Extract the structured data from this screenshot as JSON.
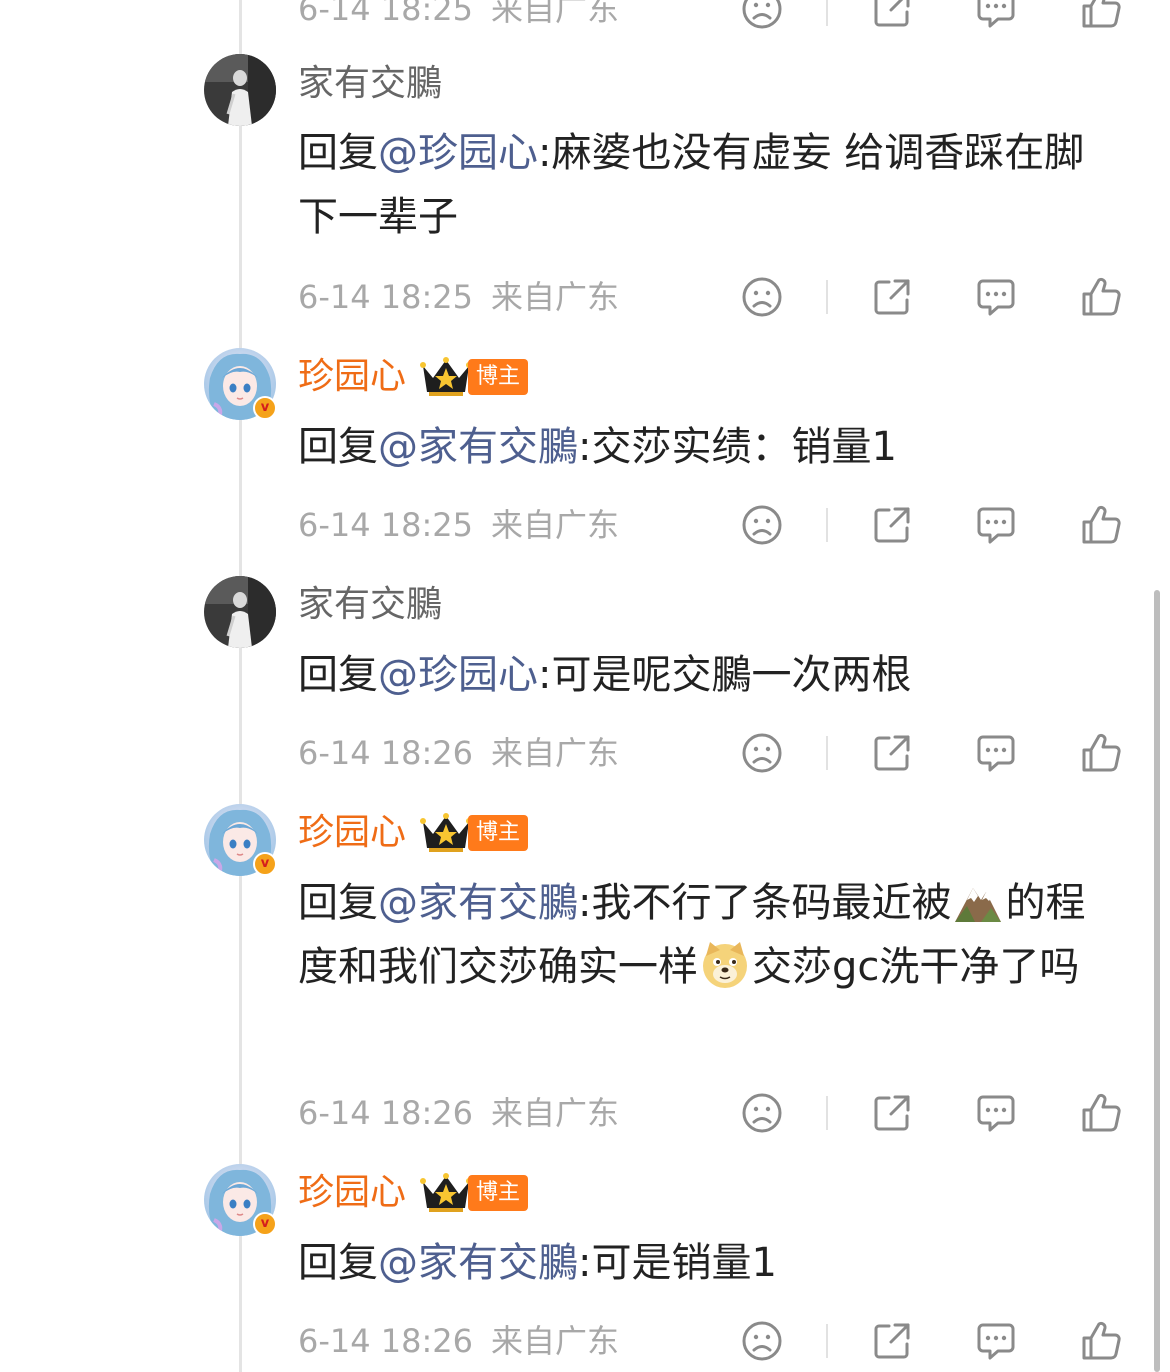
{
  "thread": {
    "partial_top_meta": {
      "date": "6-14 18:25",
      "location": "来自广东"
    },
    "comments": [
      {
        "author": "家有交鵩",
        "is_blogger": false,
        "segments": [
          {
            "type": "text",
            "value": "回复"
          },
          {
            "type": "mention",
            "value": "@珍园心"
          },
          {
            "type": "text",
            "value": ":麻婆也没有虚妄 给调香踩在脚下一辈子"
          }
        ],
        "date": "6-14 18:25",
        "location": "来自广东"
      },
      {
        "author": "珍园心",
        "is_blogger": true,
        "badge_label": "博主",
        "segments": [
          {
            "type": "text",
            "value": "回复"
          },
          {
            "type": "mention",
            "value": "@家有交鵩"
          },
          {
            "type": "text",
            "value": ":交莎实绩：销量1"
          }
        ],
        "date": "6-14 18:25",
        "location": "来自广东"
      },
      {
        "author": "家有交鵩",
        "is_blogger": false,
        "segments": [
          {
            "type": "text",
            "value": "回复"
          },
          {
            "type": "mention",
            "value": "@珍园心"
          },
          {
            "type": "text",
            "value": ":可是呢交鵩一次两根"
          }
        ],
        "date": "6-14 18:26",
        "location": "来自广东"
      },
      {
        "author": "珍园心",
        "is_blogger": true,
        "badge_label": "博主",
        "segments": [
          {
            "type": "text",
            "value": "回复"
          },
          {
            "type": "mention",
            "value": "@家有交鵩"
          },
          {
            "type": "text",
            "value": ":我不行了条码最近被"
          },
          {
            "type": "emoji",
            "value": "mountain-emoji"
          },
          {
            "type": "text",
            "value": "的程度和我们交莎确实一样"
          },
          {
            "type": "emoji",
            "value": "doge-emoji"
          },
          {
            "type": "text",
            "value": "交莎gc洗干净了吗"
          }
        ],
        "date": "6-14 18:26",
        "location": "来自广东"
      },
      {
        "author": "珍园心",
        "is_blogger": true,
        "badge_label": "博主",
        "segments": [
          {
            "type": "text",
            "value": "回复"
          },
          {
            "type": "mention",
            "value": "@家有交鵩"
          },
          {
            "type": "text",
            "value": ":可是销量1"
          }
        ],
        "date": "6-14 18:26",
        "location": "来自广东"
      }
    ]
  },
  "icons": {
    "dislike": "sad-face-icon",
    "share": "share-icon",
    "reply": "comment-icon",
    "like": "thumbs-up-icon"
  },
  "colors": {
    "author_name": "#666666",
    "blogger_name": "#ef6c16",
    "mention": "#4e5f8f",
    "body_text": "#222222",
    "meta_text": "#a8a8a8",
    "blogger_tag": "#ff7a1a",
    "verified_badge": "#f5a21a"
  }
}
